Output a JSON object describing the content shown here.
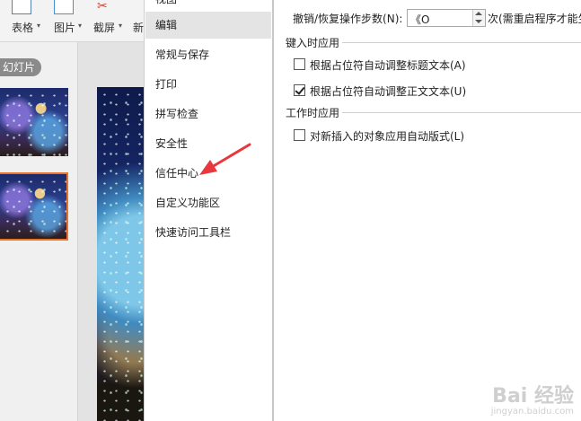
{
  "ribbon": {
    "table_label": "表格",
    "picture_label": "图片",
    "screenshot_label": "截屏",
    "cut_label": "新"
  },
  "left_panel": {
    "slides_tab": "幻灯片"
  },
  "dialog": {
    "nav_items": [
      {
        "label": "视图",
        "selected": false
      },
      {
        "label": "编辑",
        "selected": true
      },
      {
        "label": "常规与保存",
        "selected": false
      },
      {
        "label": "打印",
        "selected": false
      },
      {
        "label": "拼写检查",
        "selected": false
      },
      {
        "label": "安全性",
        "selected": false
      },
      {
        "label": "信任中心",
        "selected": false
      },
      {
        "label": "自定义功能区",
        "selected": false
      },
      {
        "label": "快速访问工具栏",
        "selected": false
      }
    ],
    "undo_label": "撤销/恢复操作步数(N):",
    "undo_value": "《O",
    "undo_suffix": "次(需重启程序才能生",
    "group_typing": "键入时应用",
    "opt_title_autofit": "根据占位符自动调整标题文本(A)",
    "opt_title_autofit_checked": false,
    "opt_body_autofit": "根据占位符自动调整正文文本(U)",
    "opt_body_autofit_checked": true,
    "group_working": "工作时应用",
    "opt_auto_layout": "对新插入的对象应用自动版式(L)",
    "opt_auto_layout_checked": false
  },
  "annotation": {
    "arrow_color": "#e8383d"
  },
  "watermark": {
    "brand": "Bai 经验",
    "url": "jingyan.baidu.com"
  }
}
